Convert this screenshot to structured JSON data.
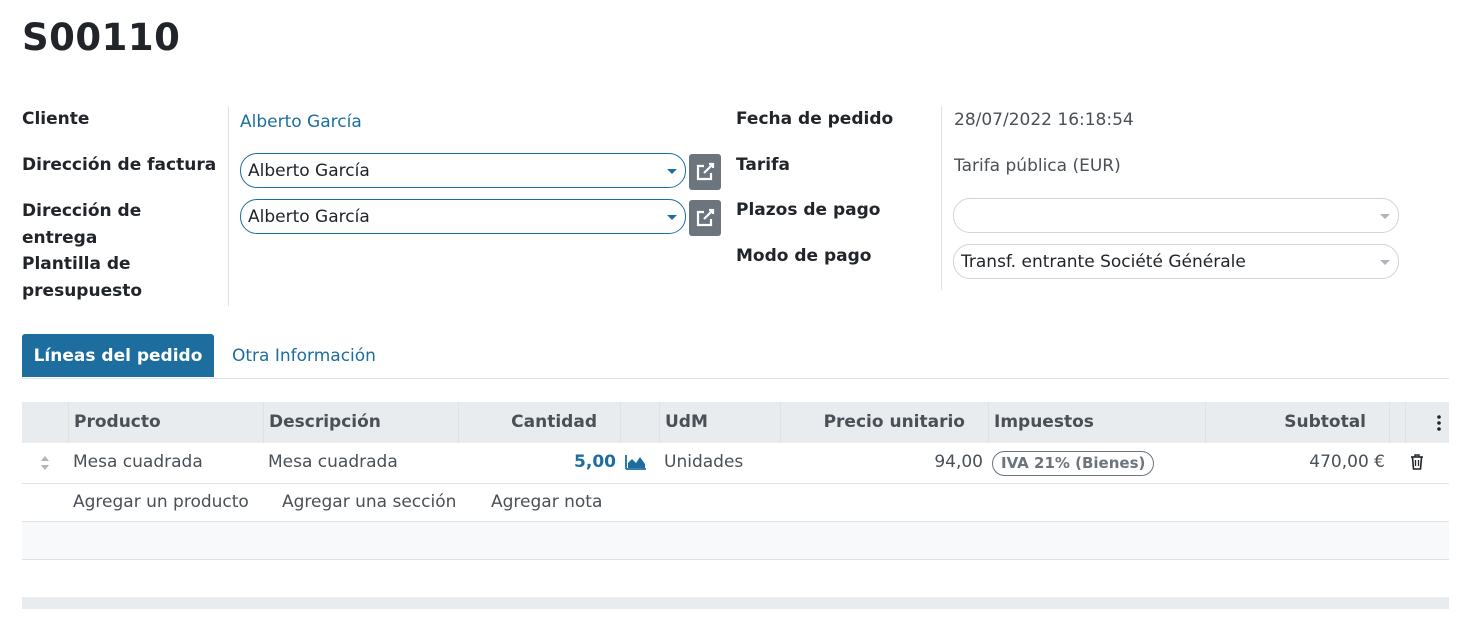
{
  "record": {
    "title": "S00110"
  },
  "left_fields": {
    "customer_label": "Cliente",
    "customer_value": "Alberto García",
    "invoice_label": "Dirección de factura",
    "invoice_value": "Alberto García",
    "delivery_label_1": "Dirección de",
    "delivery_label_2": "entrega",
    "delivery_value": "Alberto García",
    "template_label_1": "Plantilla de",
    "template_label_2": "presupuesto"
  },
  "right_fields": {
    "date_label": "Fecha de pedido",
    "date_value": "28/07/2022 16:18:54",
    "pricelist_label": "Tarifa",
    "pricelist_value": "Tarifa pública (EUR)",
    "terms_label": "Plazos de pago",
    "terms_value": "",
    "payment_label": "Modo de pago",
    "payment_value": "Transf. entrante Société Générale"
  },
  "tabs": {
    "active": "Líneas del pedido",
    "other": "Otra Información"
  },
  "table": {
    "headers": {
      "product": "Producto",
      "description": "Descripción",
      "quantity": "Cantidad",
      "uom": "UdM",
      "unit_price": "Precio unitario",
      "taxes": "Impuestos",
      "subtotal": "Subtotal"
    },
    "rows": [
      {
        "product": "Mesa cuadrada",
        "description": "Mesa cuadrada",
        "quantity": "5,00",
        "uom": "Unidades",
        "unit_price": "94,00",
        "tax": "IVA 21% (Bienes)",
        "subtotal": "470,00 €"
      }
    ],
    "actions": {
      "add_product": "Agregar un producto",
      "add_section": "Agregar una sección",
      "add_note": "Agregar nota"
    }
  },
  "colors": {
    "primary": "#1d6e9e",
    "header_bg": "#e9ecef",
    "button_grey": "#6c757d"
  },
  "icons": [
    "external-link-icon",
    "drag-handle-icon",
    "forecast-chart-icon",
    "trash-icon",
    "kebab-menu-icon"
  ]
}
